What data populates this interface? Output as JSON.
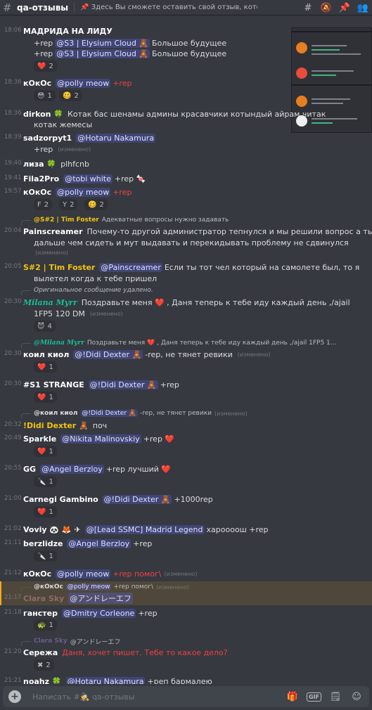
{
  "header": {
    "channel_name": "qa-отзывы",
    "topic": "📌 Здесь Вы сможете оставить свой отзыв, который ..."
  },
  "messages": [
    {
      "time": "18:06",
      "name": "МАДРИДА НА ЛИДУ"
    },
    {
      "lines": [
        {
          "text": "+rep",
          "mention": "@S3 | Elysium Cloud 🧸",
          "after": "Большое будущее"
        },
        {
          "text": "+rep",
          "mention": "@S3 | Elysium Cloud 🧸",
          "after": "Большое будущее"
        }
      ],
      "reaction": {
        "emoji": "❤️",
        "count": "2"
      }
    },
    {
      "time": "18:36",
      "name": "кОкОс",
      "mention": "@polly meow",
      "text_red": "+rep",
      "reactions": [
        {
          "emoji": "😳",
          "count": "1"
        },
        {
          "emoji": "🥴",
          "count": "2"
        }
      ]
    },
    {
      "time": "18:36",
      "name": "dirkon 🍀",
      "text": "Котак бас шенамы админы красавчики котындый айрам читак",
      "text2": "котак жемесы"
    },
    {
      "time": "18:39",
      "name": "sadzorpyt1",
      "mention": "@Hotaru Nakamura",
      "text2": "+rep",
      "edited": "(изменено)"
    },
    {
      "time": "19:40",
      "name": "лиза 🍀",
      "text": "plhfcnb"
    },
    {
      "time": "19:41",
      "name": "Fila2Pro",
      "mention": "@tobi white",
      "text": "+rep 🍬"
    },
    {
      "time": "19:57",
      "name": "кОкОс",
      "mention": "@polly meow",
      "text_red": "+rep",
      "reactions": [
        {
          "emoji": "F",
          "count": "2"
        },
        {
          "emoji": "Y",
          "count": "2"
        },
        {
          "emoji": "🥴",
          "count": "2"
        }
      ]
    },
    {
      "reply": {
        "name": "@S#2 | Tim Foster",
        "text": "Адекватные вопросы нужно задавать"
      },
      "time": "20:04",
      "name": "Painscreamer",
      "text": "Почему-то другой администратор тепнулся и мы решили вопрос а ты",
      "text2": "дальше чем сидеть и мут выдавать и перекидывать проблему не сдвинулся",
      "edited": "(изменено)"
    },
    {
      "time": "20:05",
      "name": "S#2 | Tim Foster",
      "mention": "@Painscreamer",
      "text": "Если ты тот чел который на самолете был, то я",
      "text2": "вылетел когда к тебе пришел"
    },
    {
      "reply": {
        "text": "Оригинальное сообщение удалено."
      },
      "time": "20:30",
      "name": "Milana Myrr",
      "text": "Поздравьте меня ❤️ , Даня теперь к тебе иду каждый день ,/ajail",
      "text2": "1FP5 120 DM",
      "edited": "(изменено)",
      "reaction": {
        "emoji": "😈",
        "count": "4"
      }
    },
    {
      "reply": {
        "name": "@Milana Myrr",
        "text": "Поздравьте меня ❤️ , Даня теперь к тебе иду каждый день ,/ajail 1FP5 1..."
      },
      "time": "20:30",
      "name": "коил киол",
      "mention": "@!Didi Dexter 🧸",
      "text": "-rep, не тянет ревики",
      "edited": "(изменено)",
      "reaction": {
        "emoji": "❤️",
        "count": "1"
      }
    },
    {
      "time": "20:30",
      "name": "#S1 STRANGE",
      "mention": "@!Didi Dexter 🧸",
      "text": "+rep",
      "reaction": {
        "emoji": "❤️",
        "count": "1"
      }
    },
    {
      "reply": {
        "name": "@коил киол",
        "mention": "@!Didi Dexter 🧸",
        "text": "-rep, не тянет ревики",
        "edited": "(изменено)"
      },
      "time": "20:32",
      "name": "!Didi Dexter 🧸",
      "text": "поч"
    },
    {
      "time": "20:49",
      "name": "Sparkle",
      "mention": "@Nikita Malinovskiy",
      "text": "+rep ❤️",
      "reaction": {
        "emoji": "❤️",
        "count": "1"
      }
    },
    {
      "time": "20:55",
      "name": "GG",
      "mention": "@Angel Berzloy",
      "text": "+rep лучший ❤️",
      "reaction": {
        "emoji": "🔪",
        "count": "1"
      }
    },
    {
      "time": "21:00",
      "name": "Carnegi Gambino",
      "mention": "@!Didi Dexter 🧸",
      "text": "+1000rep",
      "reaction": {
        "emoji": "❤️",
        "count": "1"
      }
    },
    {
      "time": "21:02",
      "name": "Voviy 🐼 🦊 ✈",
      "mention": "@[Lead SSMC] Madrid Legend",
      "text": "хароооош +rep"
    },
    {
      "time": "21:11",
      "name": "berzlidze",
      "mention": "@Angel Berzloy",
      "text": "+rep",
      "reaction": {
        "emoji": "🔪",
        "count": "1"
      }
    },
    {
      "time": "21:12",
      "name": "кОкОс",
      "mention": "@polly meow",
      "text_red": "+rep помог\\",
      "edited": "(изменено)"
    },
    {
      "reply": {
        "name": "@кОкОс",
        "mention": "@polly meow",
        "text": "+rep помог\\",
        "edited": "(изменено)"
      },
      "time": "21:17",
      "name": "Сlara Sky",
      "mention": "@アンドレーエフ"
    },
    {
      "time": "21:18",
      "name": "ганстер",
      "mention": "@Dmitry Corleone",
      "text": "+rep",
      "reaction": {
        "emoji": "🐢",
        "count": "1"
      }
    },
    {
      "reply": {
        "name": "Сlara Sky",
        "text": "@アンドレーエフ"
      },
      "time": "21:20",
      "name": "Сережа",
      "text_red": "Даня, хочет пишет. Тебе то какое дело?",
      "reaction": {
        "emoji": "✖",
        "count": "2"
      }
    },
    {
      "time": "21:21",
      "name": "noahz 🍀",
      "mention": "@Hotaru Nakamura",
      "text": "+реп бармалею"
    }
  ],
  "composer": {
    "placeholder": "Написать #🕵 qa-отзывы",
    "gif_label": "GIF"
  }
}
